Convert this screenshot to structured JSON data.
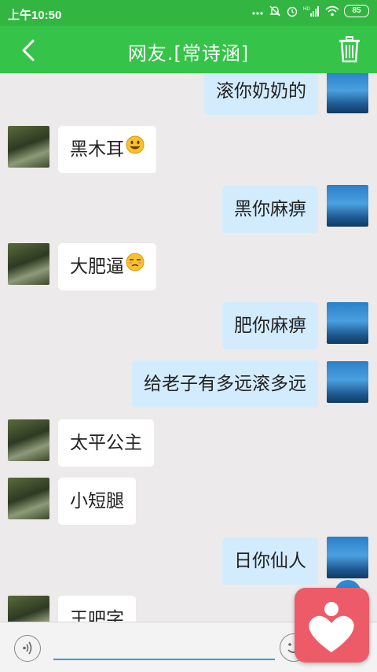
{
  "status_bar": {
    "time": "上午10:50",
    "signal_label": "HD",
    "battery": "85"
  },
  "header": {
    "title": "网友.[常诗涵]",
    "back_icon": "chevron-left-icon",
    "trash_icon": "trash-icon",
    "color": "#36c34a"
  },
  "messages": [
    {
      "side": "right",
      "text": "滚你奶奶的"
    },
    {
      "side": "left",
      "text": "黑木耳",
      "emoji": "smile"
    },
    {
      "side": "right",
      "text": "黑你麻痹"
    },
    {
      "side": "left",
      "text": "大肥逼",
      "emoji": "unamused"
    },
    {
      "side": "right",
      "text": "肥你麻痹"
    },
    {
      "side": "right",
      "text": "给老子有多远滚多远"
    },
    {
      "side": "left",
      "text": "太平公主"
    },
    {
      "side": "left",
      "text": "小短腿"
    },
    {
      "side": "right",
      "text": "日你仙人"
    },
    {
      "side": "left",
      "text": "王吧字"
    }
  ],
  "input_bar": {
    "placeholder": "",
    "voice_icon": "voice-icon",
    "emoji_icon": "emoji-icon"
  },
  "floating": {
    "icon": "heart-person-icon",
    "color": "#ee5b68"
  }
}
